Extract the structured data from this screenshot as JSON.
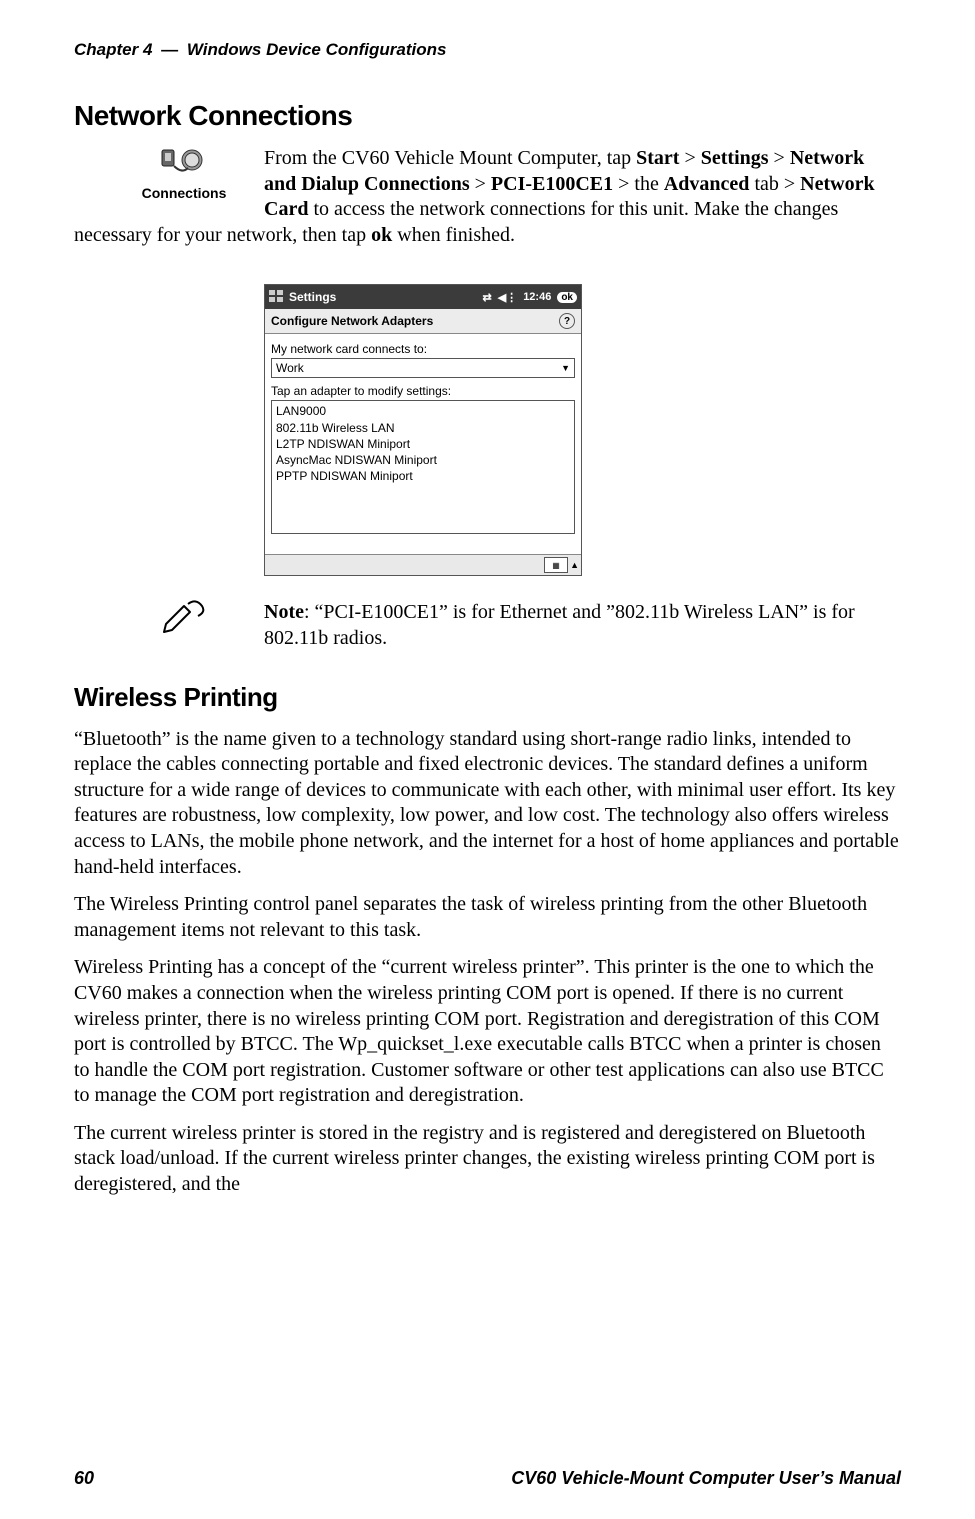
{
  "runningHead": {
    "left_chapter": "Chapter 4",
    "left_title": "Windows Device Configurations"
  },
  "section1": {
    "title": "Network Connections",
    "iconLabel": "Connections",
    "para1_prefix": "From the CV60 Vehicle Mount Computer, tap ",
    "b_start": "Start",
    "gt": " > ",
    "b_settings": "Settings",
    "b_netdial": "Network and Dialup Connections",
    "b_pci": "PCI-E100CE1",
    "txt_the": " > the ",
    "b_adv": "Advanced",
    "txt_tab": " tab > ",
    "b_netcard": "Network Card",
    "para1_suffix1": " to access the network connections for this unit. Make the changes necessary for your network, then tap ",
    "b_ok": "ok",
    "para1_suffix2": " when finished."
  },
  "wm": {
    "title": "Settings",
    "time": "12:46",
    "ok": "ok",
    "subhead": "Configure Network Adapters",
    "label1": "My network card connects to:",
    "combo_value": "Work",
    "label2": "Tap an adapter to modify settings:",
    "adapters": [
      "LAN9000",
      "802.11b Wireless LAN",
      "L2TP NDISWAN Miniport",
      "AsyncMac NDISWAN Miniport",
      "PPTP NDISWAN Miniport"
    ]
  },
  "note": {
    "b_note": "Note",
    "text": ": “PCI-E100CE1” is for Ethernet and ”802.11b Wireless LAN” is for 802.11b radios."
  },
  "section2": {
    "title": "Wireless Printing",
    "p1": "“Bluetooth” is the name given to a technology standard using short-range radio links, intended to replace the cables connecting portable and fixed electronic devices. The standard defines a uniform structure for a wide range of devices to communicate with each other, with minimal user effort. Its key features are robustness, low complexity, low power, and low cost. The technology also offers wireless access to LANs, the mobile phone network, and the internet for a host of home appliances and portable hand-held interfaces.",
    "p2": "The Wireless Printing control panel separates the task of wireless printing from the other Bluetooth management items not relevant to this task.",
    "p3": "Wireless Printing has a concept of the “current wireless printer”. This printer is the one to which the CV60 makes a connection when the wireless printing COM port is opened. If there is no current wireless printer, there is no wireless printing COM port. Registration and deregistration of this COM port is controlled by BTCC. The Wp_quickset_l.exe executable calls BTCC when a printer is chosen to handle the COM port registration. Customer software or other test applications can also use BTCC to manage the COM port registration and deregistration.",
    "p4": "The current wireless printer is stored in the registry and is registered and deregistered on Bluetooth stack load/unload. If the current wireless printer changes, the existing wireless printing COM port is deregistered, and the"
  },
  "footer": {
    "pageno": "60",
    "doc": "CV60 Vehicle-Mount Computer User’s Manual"
  }
}
